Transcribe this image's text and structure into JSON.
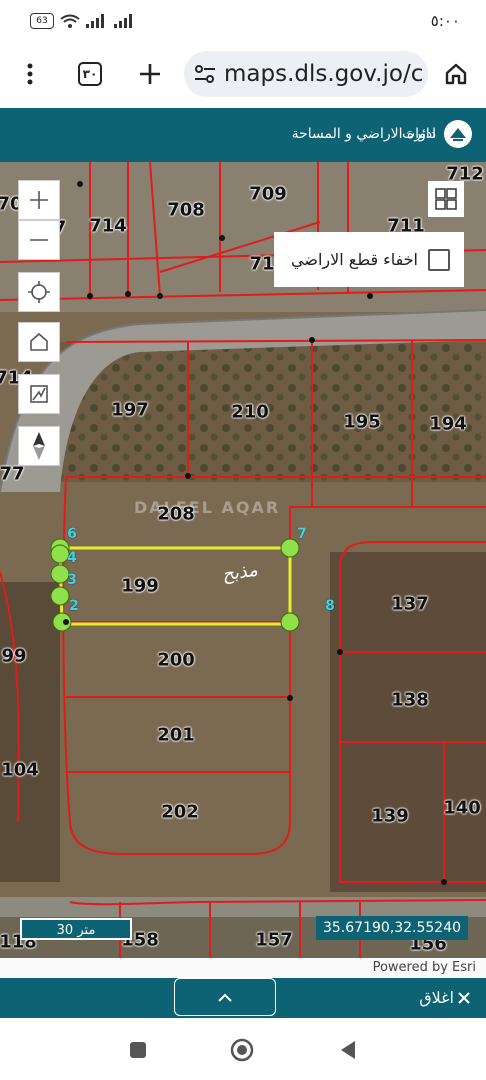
{
  "status_bar": {
    "battery": "63",
    "time": "٥:٠٠"
  },
  "browser": {
    "tab_count": "٣٠",
    "url": "maps.dls.gov.jo/c"
  },
  "app_header": {
    "title": "دائرة الاراضي و المساحة",
    "tools_label": "ادوات"
  },
  "map": {
    "hide_parcels_label": "اخفاء قطع الاراضي",
    "hide_parcels_checked": false,
    "parcels": [
      "70",
      "7",
      "714",
      "708",
      "709",
      "712",
      "711",
      "71",
      "714",
      "77",
      "197",
      "210",
      "195",
      "194",
      "208",
      "199",
      "137",
      "200",
      "138",
      "201",
      "104",
      "99",
      "202",
      "139",
      "140",
      "118",
      "158",
      "157",
      "156"
    ],
    "vertex_labels": [
      "6",
      "4",
      "3",
      "2",
      "7",
      "8"
    ],
    "watermark": "DALEEL AQAR",
    "annotation": "مذبح",
    "scale": "30 متر",
    "coordinates": "35.67190,32.55240",
    "attribution": "Powered by Esri"
  },
  "bottom_bar": {
    "close_label": "اغلاق"
  },
  "colors": {
    "header": "#0d6273",
    "parcel_boundary": "#e01c1c",
    "selection": "#e6ef2a",
    "vertex": "#8fe04a"
  }
}
